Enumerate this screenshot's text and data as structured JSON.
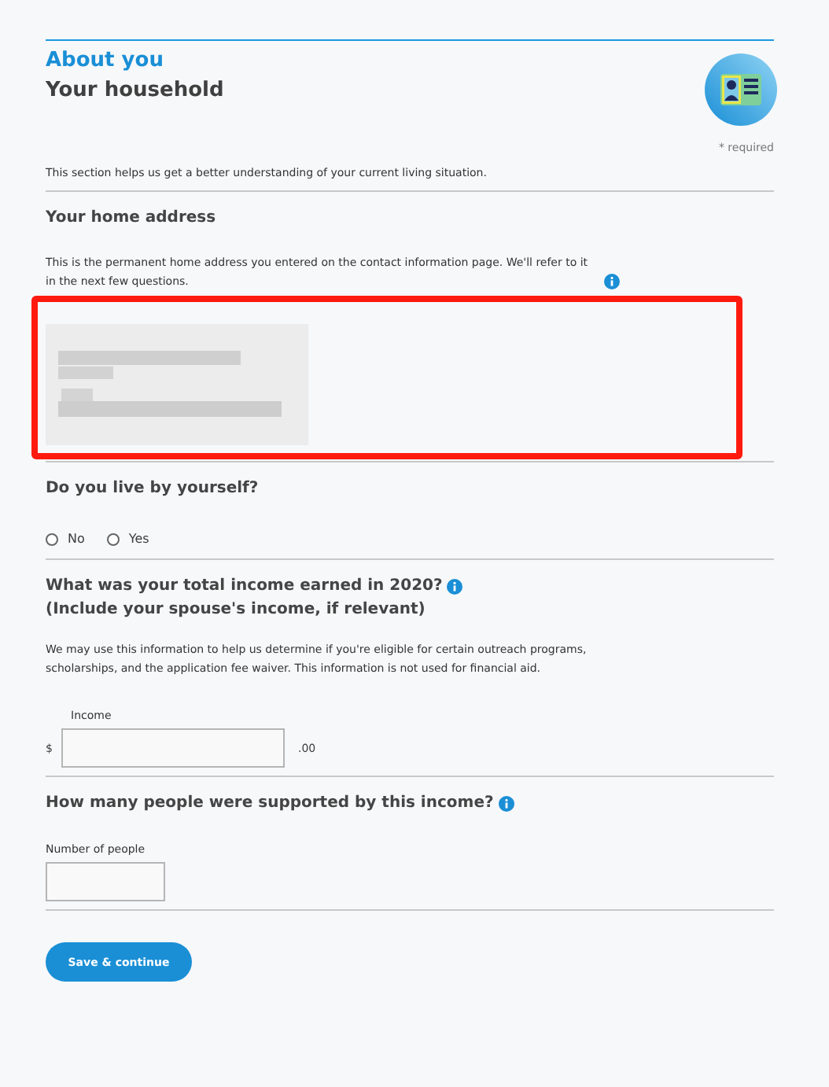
{
  "header": {
    "section": "About you",
    "title": "Your household"
  },
  "required_note": "* required",
  "intro": "This section helps us get a better understanding of your current living situation.",
  "address": {
    "heading": "Your home address",
    "description": "This is the permanent home address you entered on the contact information page. We'll refer to it in the next few questions.",
    "redacted": true,
    "highlighted": true
  },
  "live_alone": {
    "question": "Do you live by yourself?",
    "options": [
      {
        "label": "No",
        "selected": false
      },
      {
        "label": "Yes",
        "selected": false
      }
    ]
  },
  "income": {
    "question": "What was your total income earned in 2020?",
    "subquestion": "(Include your spouse's income, if relevant)",
    "description": "We may use this information to help us determine if you're eligible for certain outreach programs, scholarships, and the application fee waiver. This information is not used for financial aid.",
    "label": "Income",
    "prefix": "$",
    "suffix": ".00"
  },
  "people": {
    "question": "How many people were supported by this income?",
    "label": "Number of people"
  },
  "button": "Save & continue"
}
